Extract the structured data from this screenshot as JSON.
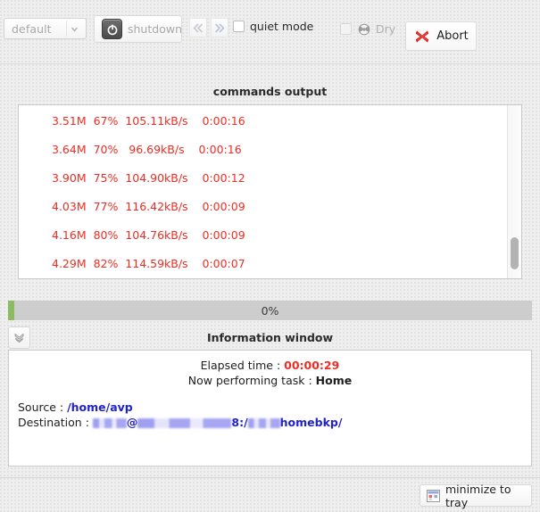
{
  "toolbar": {
    "profile_select": {
      "value": "default",
      "placeholder": "default",
      "disabled": true
    },
    "shutdown_label": "shutdown",
    "prev_icon": "rewind-icon",
    "next_icon": "fast-forward-icon",
    "quiet_mode_label": "quiet mode",
    "quiet_mode_checked": false,
    "dry_label": "Dry",
    "dry_checked": false,
    "dry_icon": "radioactive-icon",
    "abort_label": "Abort",
    "abort_icon": "red-x-icon"
  },
  "commands_output": {
    "title": "commands output",
    "lines": [
      "3.51M  67%  105.11kB/s    0:00:16",
      "3.64M  70%   96.69kB/s    0:00:16",
      "3.90M  75%  104.90kB/s    0:00:12",
      "4.03M  77%  116.42kB/s    0:00:09",
      "4.16M  80%  104.76kB/s    0:00:09",
      "4.29M  82%  114.59kB/s    0:00:07"
    ],
    "text_color": "#ee2d24"
  },
  "progress": {
    "label": "0%",
    "percent": 0,
    "fill_color": "#8cbb63",
    "track_color": "#cdcdcd"
  },
  "information_window": {
    "title": "Information window",
    "collapse_icon": "double-chevron-down-icon",
    "elapsed_label": "Elapsed time : ",
    "elapsed_value": "00:00:29",
    "task_label": "Now performing task : ",
    "task_value": "Home",
    "source_label": "Source : ",
    "source_value": "/home/avp",
    "destination_label": "Destination : ",
    "destination_user_redacted": "",
    "destination_at": "@",
    "destination_host_redacted": "",
    "destination_port": "8:/",
    "destination_path_redacted": "",
    "destination_tail": "homebkp/"
  },
  "footer": {
    "tray_label": "minimize to tray",
    "tray_icon": "tray-window-icon"
  }
}
